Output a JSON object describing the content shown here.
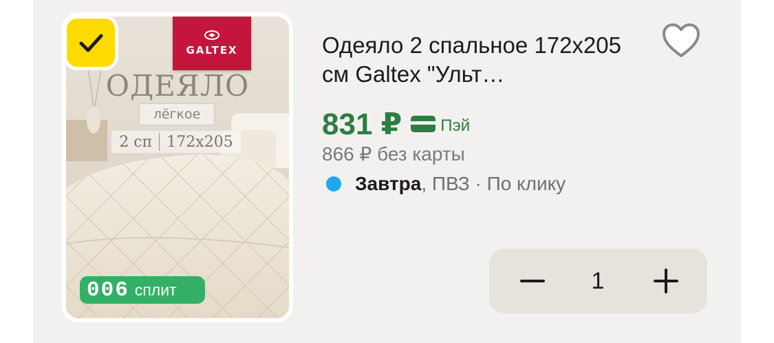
{
  "product": {
    "title": "Одеяло 2 спальное 172х205 см Galtex \"Ульт…",
    "price": "831 ₽",
    "pay_label": "Пэй",
    "price_without_card": "866 ₽ без карты",
    "delivery": {
      "day": "Завтра",
      "rest": ", ПВЗ · По клику"
    },
    "quantity": "1",
    "selected": true
  },
  "image_texts": {
    "brand": "GALTEX",
    "product_type": "ОДЕЯЛО",
    "weight": "лёгкое",
    "size_beds": "2 сп",
    "size_dims": "172х205"
  },
  "badge": {
    "logo": "006",
    "label": "сплит"
  },
  "icons": {
    "checkbox": "checkmark-icon",
    "favorite": "heart-outline-icon",
    "pay": "card-icon",
    "minus": "minus-icon",
    "plus": "plus-icon"
  },
  "colors": {
    "price_green": "#2e7d43",
    "checkbox_yellow": "#fedb00",
    "split_green": "#33b065",
    "delivery_dot": "#1fa8ef",
    "brand_red": "#c4163c"
  }
}
